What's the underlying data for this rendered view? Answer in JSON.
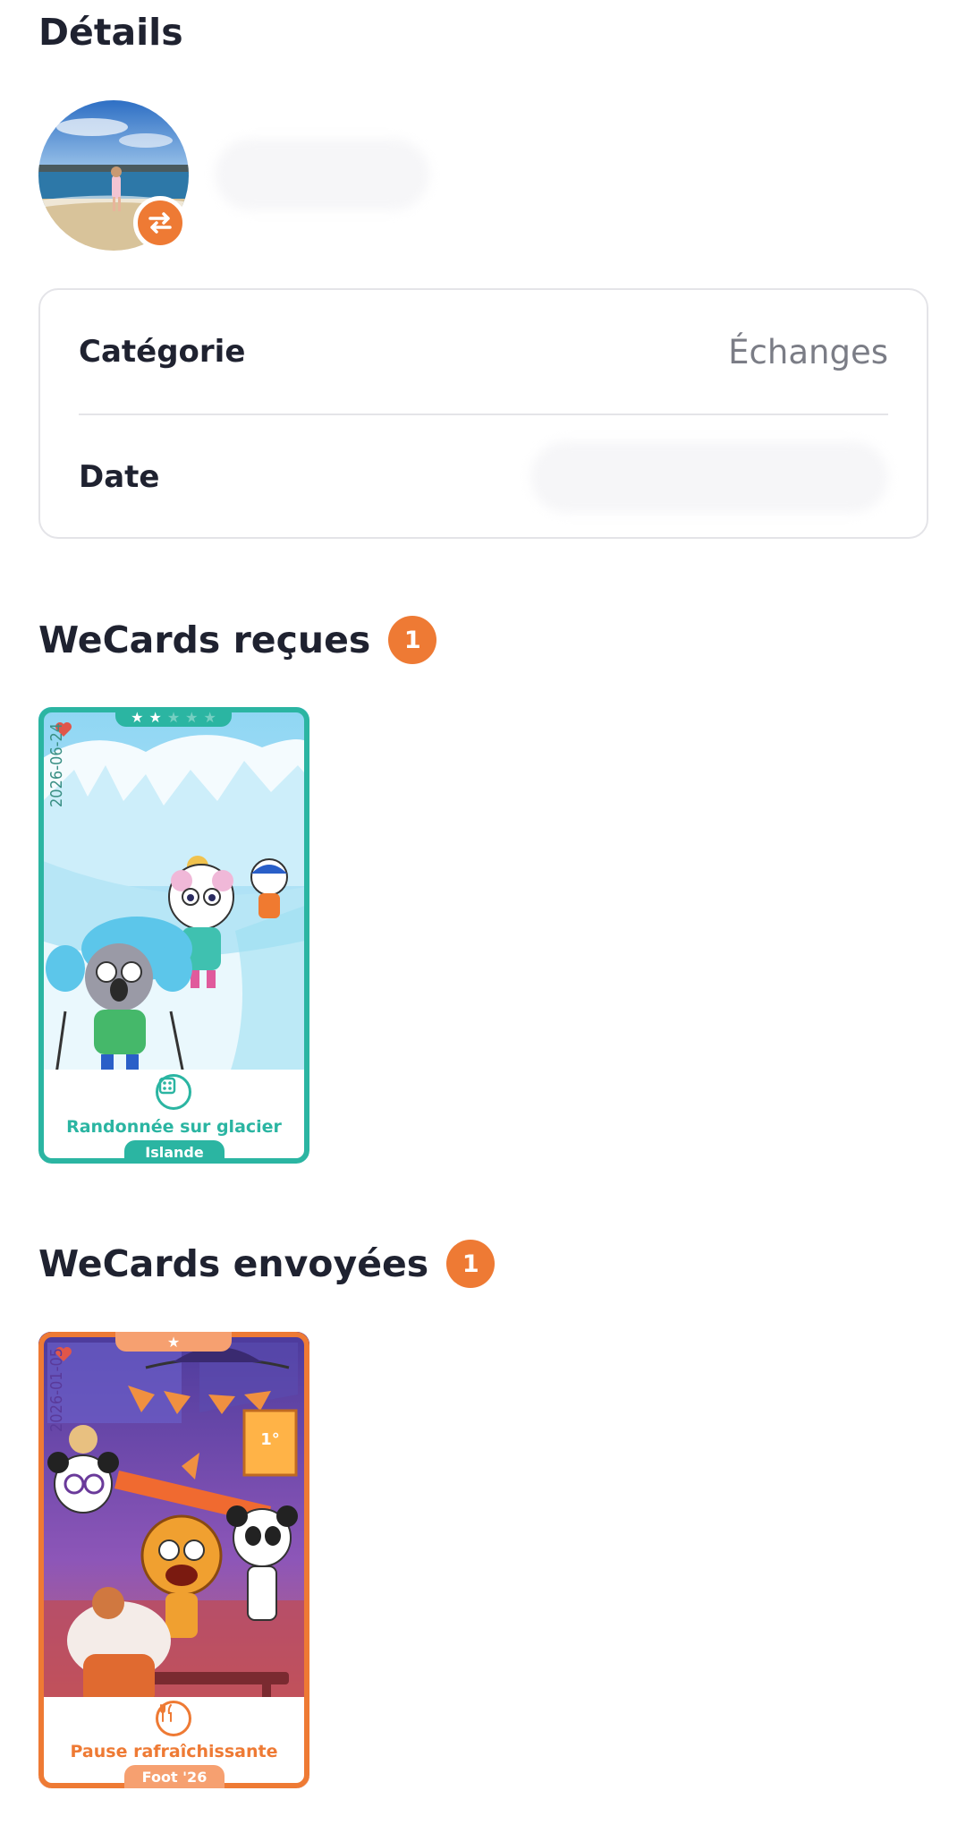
{
  "header": {
    "title": "Détails"
  },
  "details": {
    "rows": [
      {
        "label": "Catégorie",
        "value": "Échanges"
      },
      {
        "label": "Date",
        "value": ""
      }
    ]
  },
  "received": {
    "title": "WeCards reçues",
    "count": "1",
    "card": {
      "date": "2026-06-24",
      "name": "Randonnée sur glacier",
      "region": "Islande",
      "stars_filled": 2,
      "stars_total": 5,
      "category_icon": "dice-icon",
      "accent": "#2bb5a2"
    }
  },
  "sent": {
    "title": "WeCards envoyées",
    "count": "1",
    "card": {
      "date": "2026-01-05",
      "name": "Pause rafraîchissante",
      "region": "Foot '26",
      "stars_filled": 1,
      "stars_total": 1,
      "category_icon": "cutlery-icon",
      "accent": "#ee7a34"
    }
  },
  "colors": {
    "accent": "#ee7a34",
    "teal": "#2bb5a2",
    "border": "#e4e4e8",
    "muted": "#7b7d86"
  }
}
